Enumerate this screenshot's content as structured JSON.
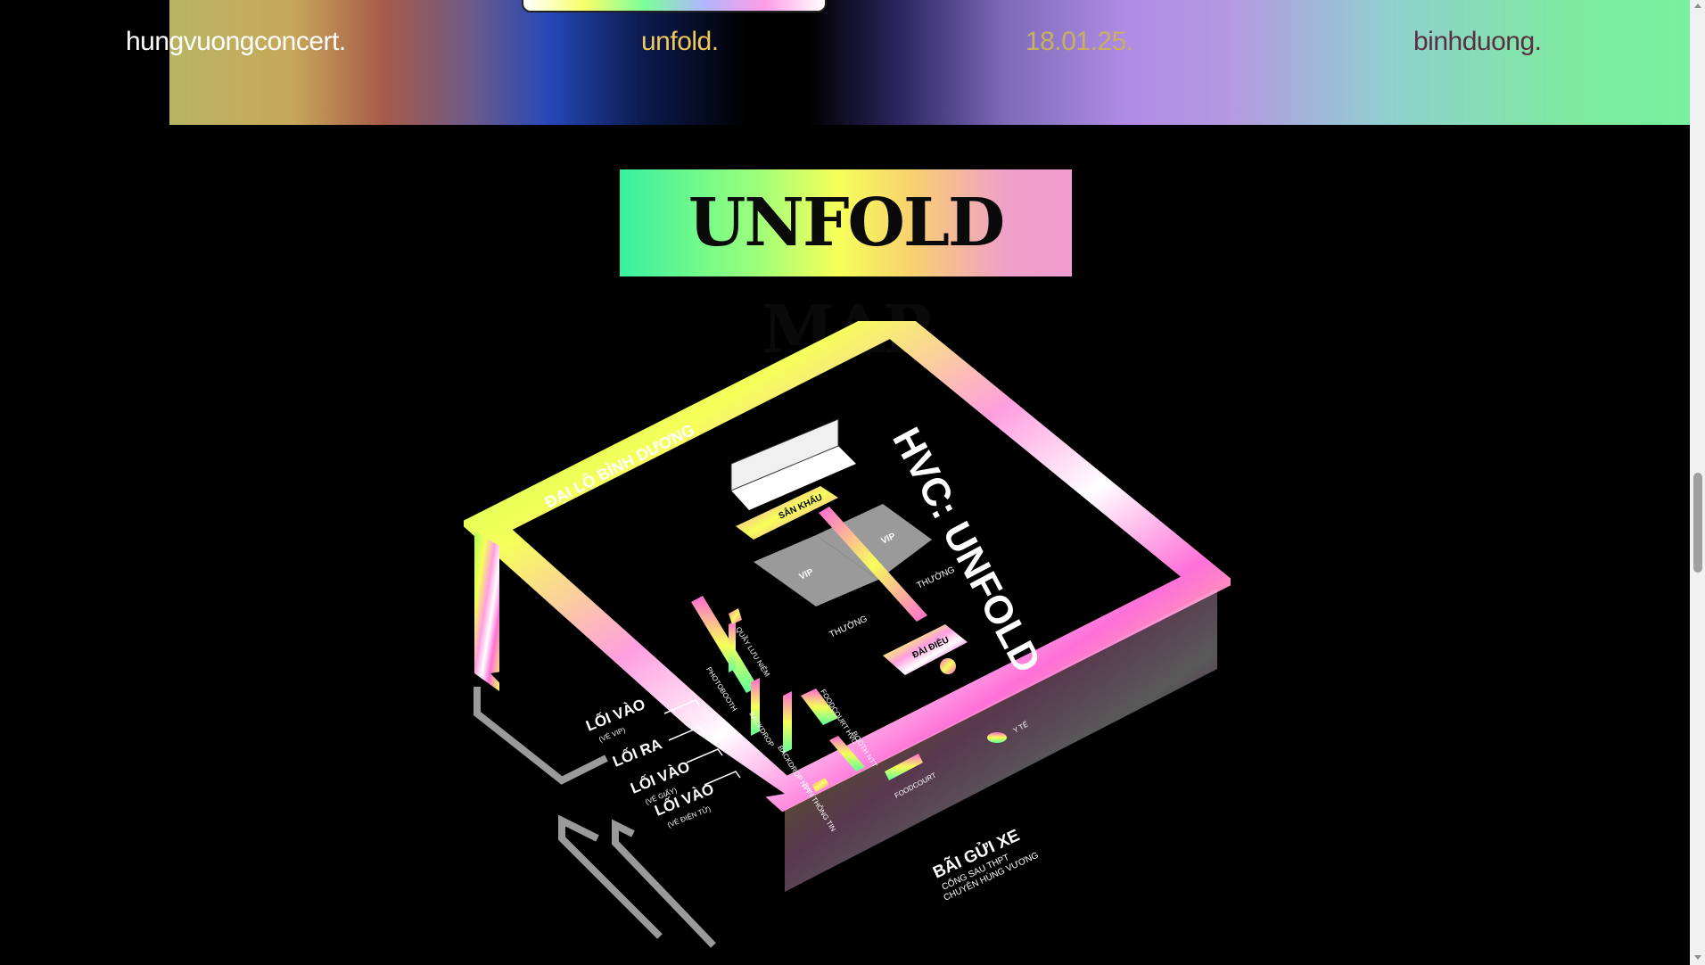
{
  "nav": {
    "brand": "hungvuongconcert.",
    "event": "unfold.",
    "date": "18.01.25.",
    "location": "binhduong."
  },
  "map_title": "UNFOLD MAP",
  "venue_map": {
    "road_label": "ĐẠI LỘ BÌNH DƯƠNG",
    "event_logo": "HVC: UNFOLD",
    "stage": "SÂN KHẤU",
    "vip_left": "VIP",
    "vip_right": "VIP",
    "general_left": "THƯỜNG",
    "general_right": "THƯỜNG",
    "tower": "ĐÀI ĐIỀU",
    "souvenir": "QUẦY LƯU NIỆM",
    "photobooth": "PHOTOBOOTH",
    "backdrop": "BACKDROP",
    "backdrop_ntt": "BACKDROP NTT",
    "info_desk": "BÀN THÔNG TIN",
    "foodcourt_hvc": "FOODCOURT HVC",
    "booth_ntt": "BOOTH NTT",
    "foodcourt": "FOODCOURT",
    "medical": "Y TẾ",
    "entrance_vip": "LỐI VÀO",
    "entrance_vip_sub": "(VÉ VIP)",
    "exit": "LỐI RA",
    "entrance_paper": "LỐI VÀO",
    "entrance_paper_sub": "(VÉ GIẤY)",
    "entrance_eticket": "LỐI VÀO",
    "entrance_eticket_sub": "(VÉ ĐIỆN TỬ)",
    "parking": "BÃI GỬI XE",
    "parking_sub1": "CỔNG SAU THPT",
    "parking_sub2": "CHUYÊN HÙNG VƯƠNG"
  },
  "colors": {
    "background": "#000000",
    "accent_pink": "#ff6ad5",
    "accent_yellow": "#f6ff5a",
    "accent_green": "#5cff9a"
  }
}
